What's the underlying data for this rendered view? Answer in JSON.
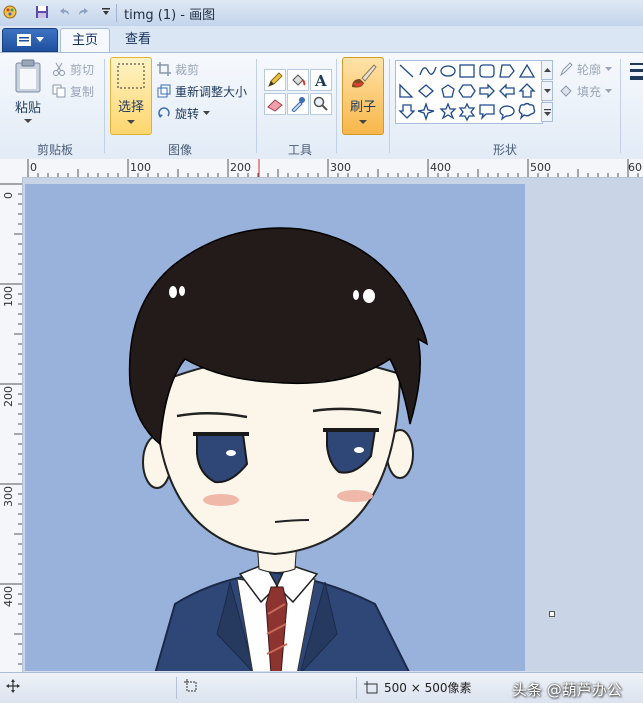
{
  "window": {
    "title": "timg (1) - 画图"
  },
  "tabs": {
    "home": "主页",
    "view": "查看"
  },
  "clipboard": {
    "paste": "粘贴",
    "cut": "剪切",
    "copy": "复制",
    "group": "剪贴板"
  },
  "image": {
    "select": "选择",
    "crop": "裁剪",
    "resize": "重新调整大小",
    "rotate": "旋转",
    "group": "图像"
  },
  "tools": {
    "group": "工具"
  },
  "brushes": {
    "label": "刷子"
  },
  "shapes": {
    "outline": "轮廓",
    "fill": "填充",
    "group": "形状"
  },
  "ruler": {
    "h_marks": [
      "0",
      "100",
      "200",
      "300",
      "400",
      "500",
      "60"
    ],
    "v_marks": [
      "0",
      "100",
      "200",
      "300",
      "400"
    ]
  },
  "status": {
    "size": "500 × 500像素",
    "watermark": "头条 @葫芦办公"
  }
}
